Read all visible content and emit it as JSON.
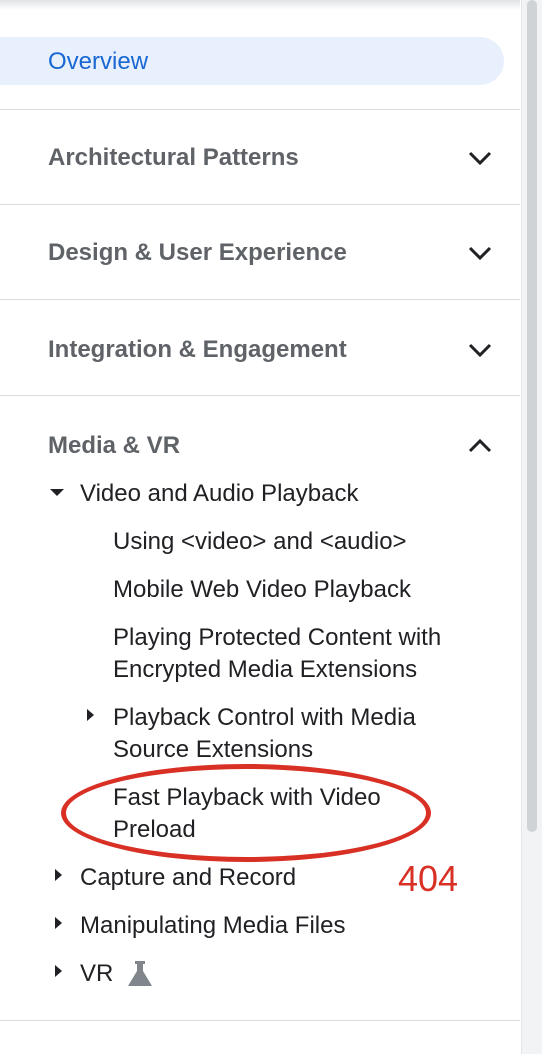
{
  "nav": {
    "overview_label": "Overview",
    "sections": [
      {
        "label": "Architectural Patterns",
        "expanded": false
      },
      {
        "label": "Design & User Experience",
        "expanded": false
      },
      {
        "label": "Integration & Engagement",
        "expanded": false
      },
      {
        "label": "Media & VR",
        "expanded": true
      }
    ],
    "media": {
      "video_audio": "Video and Audio Playback",
      "using_video_audio": "Using <video> and <audio>",
      "mobile_video": "Mobile Web Video Playback",
      "protected_line1": "Playing Protected Content with",
      "protected_line2": "Encrypted Media Extensions",
      "mse_line1": "Playback Control with Media",
      "mse_line2": "Source Extensions",
      "fast_line1": "Fast Playback with Video",
      "fast_line2": "Preload",
      "capture": "Capture and Record",
      "manipulating": "Manipulating Media Files",
      "vr": "VR"
    }
  },
  "annotation": {
    "label": "404",
    "color": "#d93025"
  },
  "colors": {
    "accent": "#1967d2",
    "selected_bg": "#e8f0fe",
    "section_text": "#5f6368"
  },
  "icons": {
    "expand": "chevron-down-icon",
    "collapse": "chevron-up-icon",
    "vr_badge": "flask-icon"
  }
}
